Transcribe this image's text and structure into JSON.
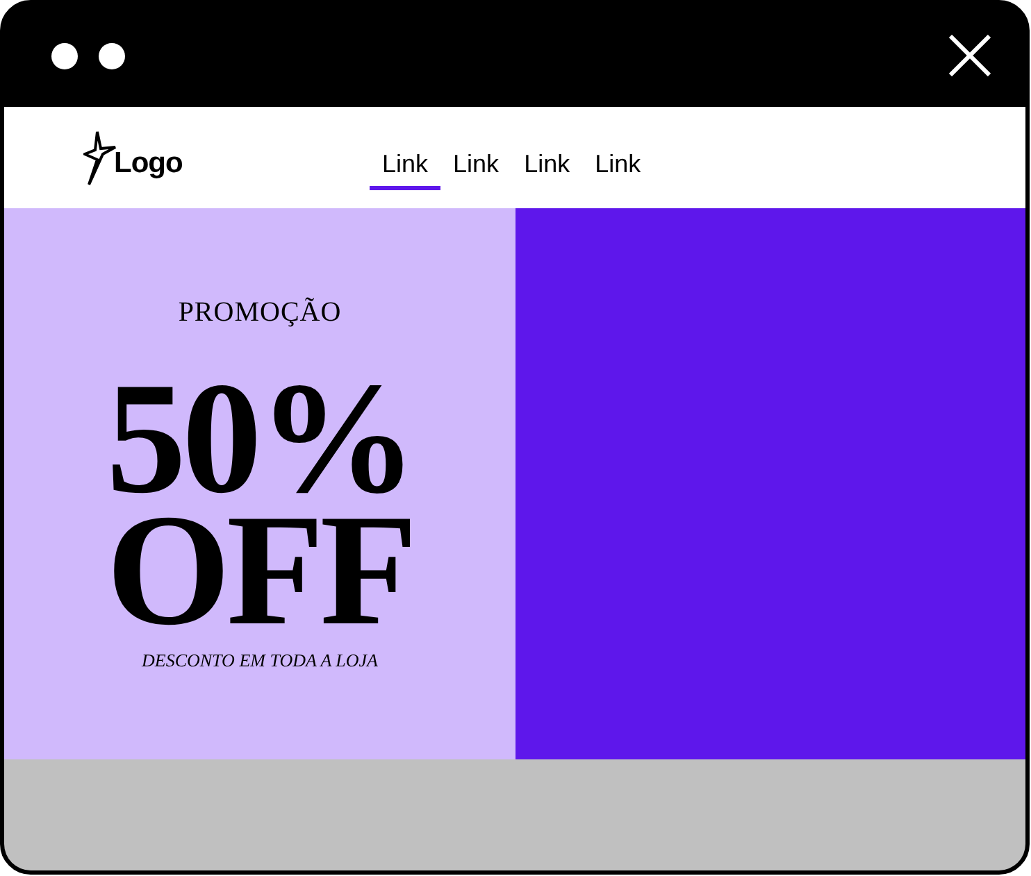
{
  "nav": {
    "logo": "Logo",
    "links": [
      {
        "label": "Link",
        "selected": true
      },
      {
        "label": "Link",
        "selected": false
      },
      {
        "label": "Link",
        "selected": false
      },
      {
        "label": "Link",
        "selected": false
      }
    ]
  },
  "promo": {
    "eyebrow": "PROMOÇÃO",
    "headline": [
      "50%",
      "OFF"
    ],
    "tagline": "DESCONTO EM TODA A LOJA"
  }
}
